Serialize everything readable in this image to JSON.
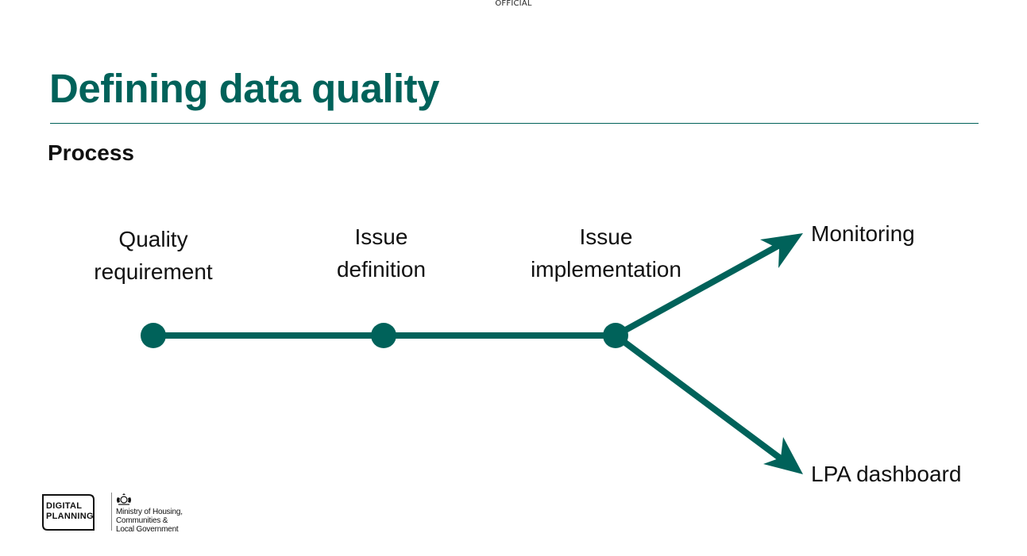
{
  "header": {
    "classification": "OFFICIAL"
  },
  "slide": {
    "title": "Defining data quality",
    "section_heading": "Process"
  },
  "diagram": {
    "stages": [
      {
        "label_line1": "Quality",
        "label_line2": "requirement"
      },
      {
        "label_line1": "Issue",
        "label_line2": "definition"
      },
      {
        "label_line1": "Issue",
        "label_line2": "implementation"
      }
    ],
    "outcomes": [
      {
        "label": "Monitoring"
      },
      {
        "label": "LPA dashboard"
      }
    ],
    "colors": {
      "line": "#00625a",
      "node": "#00625a"
    }
  },
  "footer": {
    "digital_planning_logo": {
      "line1": "DIGITAL",
      "line2": "PLANNING"
    },
    "ministry": {
      "crest_icon": "royal-crest-icon",
      "name": "Ministry of Housing,\nCommunities &\nLocal Government"
    }
  }
}
